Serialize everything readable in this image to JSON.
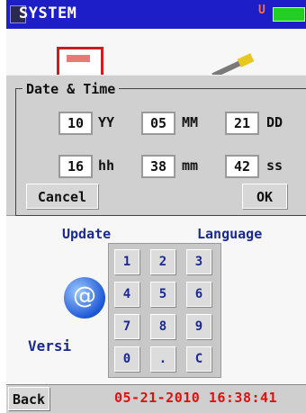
{
  "title_bar": {
    "title": "SYSTEM",
    "usb_symbol": "U"
  },
  "desktop": {
    "update_label": "Update",
    "language_label": "Language",
    "version_label": "Versi",
    "version_symbol": "@"
  },
  "dialog": {
    "group_title": "Date & Time",
    "year": "10",
    "year_unit": "YY",
    "month": "05",
    "month_unit": "MM",
    "day": "21",
    "day_unit": "DD",
    "hour": "16",
    "hour_unit": "hh",
    "minute": "38",
    "minute_unit": "mm",
    "second": "42",
    "second_unit": "ss",
    "cancel_label": "Cancel",
    "ok_label": "OK"
  },
  "keypad": {
    "keys": [
      "1",
      "2",
      "3",
      "4",
      "5",
      "6",
      "7",
      "8",
      "9",
      "0",
      ".",
      "C"
    ]
  },
  "status_bar": {
    "back_label": "Back",
    "datetime": "05-21-2010 16:38:41"
  },
  "colors": {
    "title_bar": "#1e1ec8",
    "status_time": "#e01010",
    "desktop_labels": "#1a2a90",
    "battery": "#20d020"
  }
}
